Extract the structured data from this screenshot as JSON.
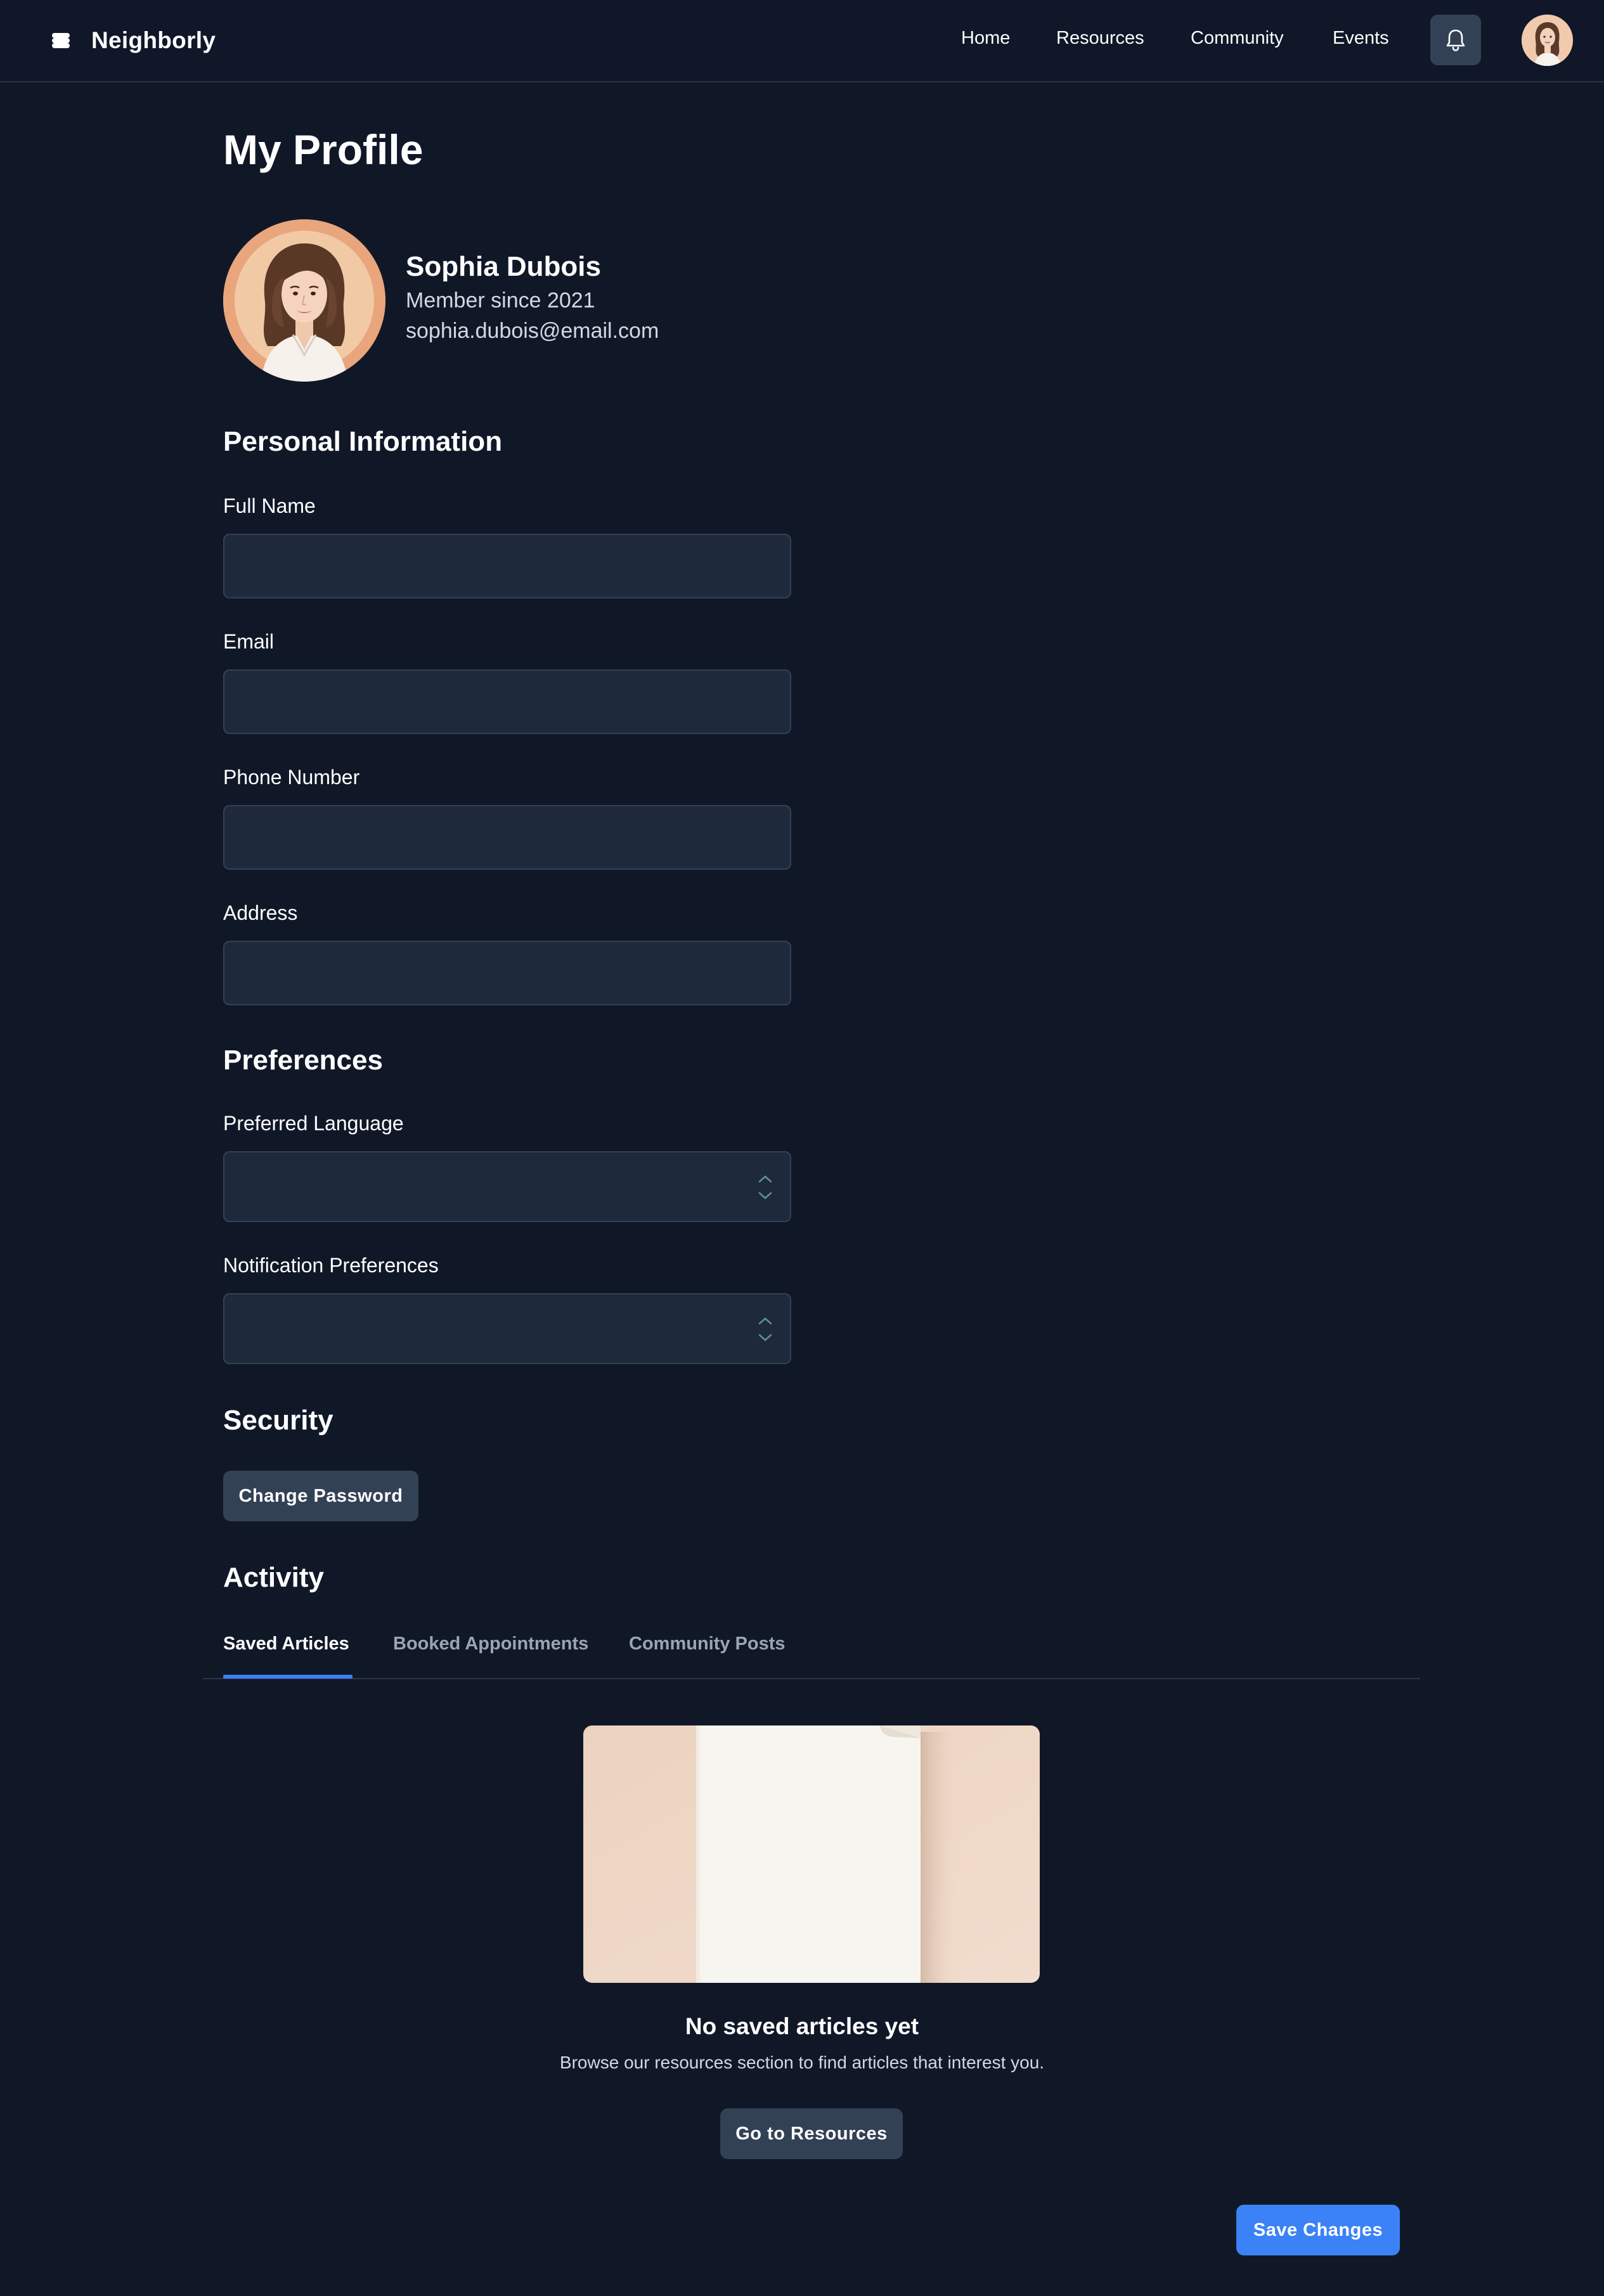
{
  "app": {
    "brand": "Neighborly"
  },
  "nav": {
    "items": [
      "Home",
      "Resources",
      "Community",
      "Events"
    ]
  },
  "icons": {
    "logo": "stacked-layers-icon",
    "notifications": "bell-icon",
    "select_arrows": "chevron-up-down-icon"
  },
  "page": {
    "title": "My Profile"
  },
  "profile": {
    "name": "Sophia Dubois",
    "member_since": "Member since 2021",
    "email": "sophia.dubois@email.com"
  },
  "personal_info": {
    "title": "Personal Information",
    "full_name": {
      "label": "Full Name",
      "value": ""
    },
    "email": {
      "label": "Email",
      "value": ""
    },
    "phone": {
      "label": "Phone Number",
      "value": ""
    },
    "address": {
      "label": "Address",
      "value": ""
    }
  },
  "preferences": {
    "title": "Preferences",
    "language": {
      "label": "Preferred Language",
      "value": ""
    },
    "notifications": {
      "label": "Notification Preferences",
      "value": ""
    }
  },
  "security": {
    "title": "Security",
    "change_password": "Change Password"
  },
  "activity": {
    "title": "Activity",
    "tabs": [
      "Saved Articles",
      "Booked Appointments",
      "Community Posts"
    ],
    "active_tab": 0,
    "empty_title": "No saved articles yet",
    "empty_description": "Browse our resources section to find articles that interest you.",
    "empty_action": "Go to Resources"
  },
  "actions": {
    "save": "Save Changes"
  },
  "colors": {
    "background": "#101828",
    "input_bg": "#1e293b",
    "accent": "#3b82f6",
    "secondary_button": "#334155"
  }
}
